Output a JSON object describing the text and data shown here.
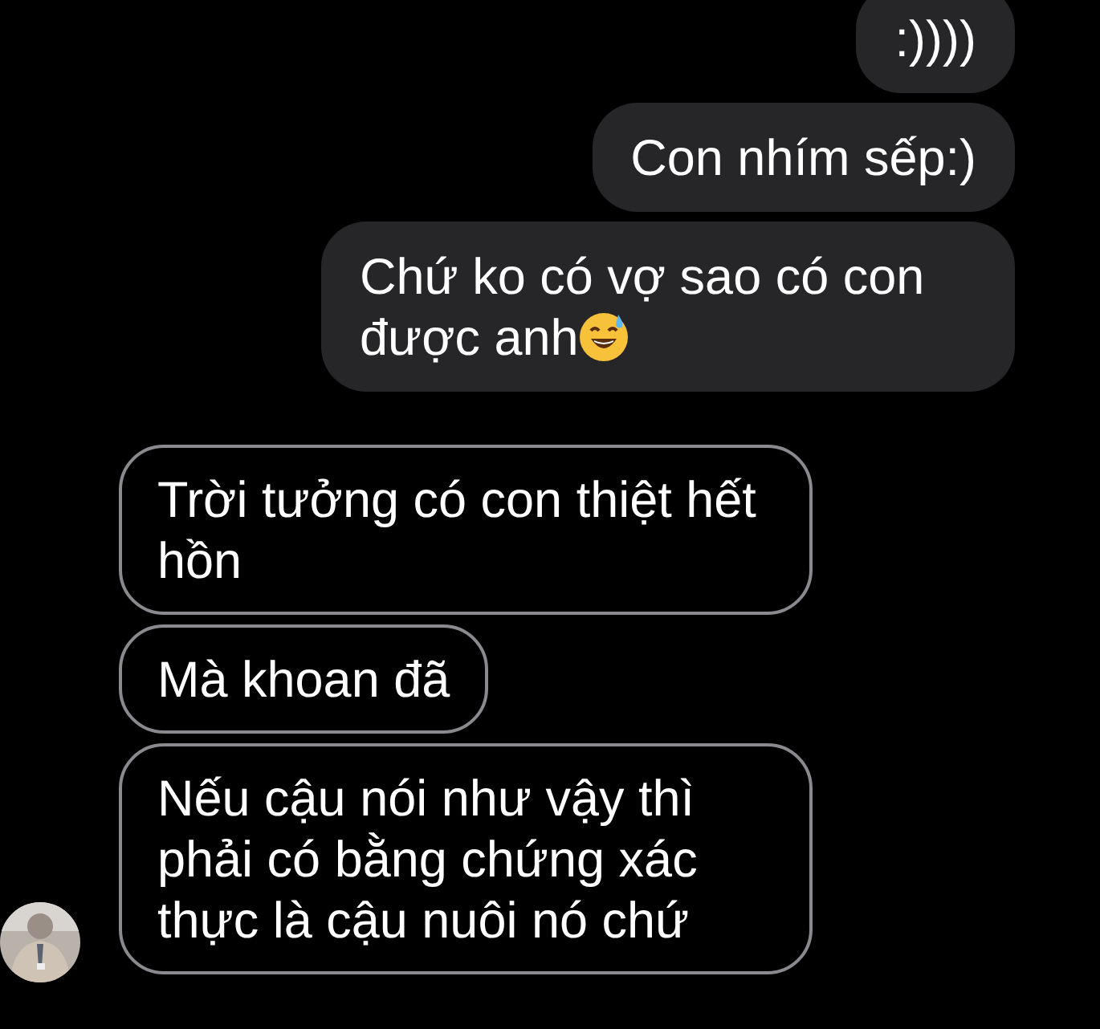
{
  "messages": [
    {
      "kind": "sent",
      "text": ":))))"
    },
    {
      "kind": "sent",
      "text": "Con nhím sếp:)"
    },
    {
      "kind": "sent",
      "text": "Chứ ko có vợ sao có con được anh",
      "emoji": true
    },
    {
      "kind": "received",
      "text": "Trời tưởng có con thiệt hết hồn"
    },
    {
      "kind": "received",
      "text": "Mà khoan đã"
    },
    {
      "kind": "received",
      "text": "Nếu cậu nói như vậy thì phải có bằng chứng xác thực là cậu nuôi nó chứ",
      "avatar": true
    }
  ]
}
